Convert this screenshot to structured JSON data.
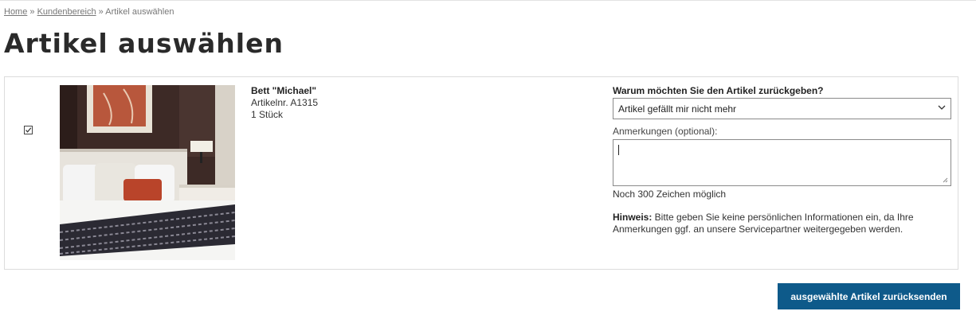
{
  "breadcrumb": {
    "items": [
      "Home",
      "Kundenbereich",
      "Artikel auswählen"
    ],
    "separator": "»"
  },
  "page_title": "Artikel auswählen",
  "item": {
    "checked": true,
    "name": "Bett \"Michael\"",
    "article_number": "Artikelnr. A1315",
    "quantity": "1 Stück",
    "image_icon": "bedroom-photo"
  },
  "return_form": {
    "reason_label": "Warum möchten Sie den Artikel zurückgeben?",
    "reason_selected": "Artikel gefällt mir nicht mehr",
    "notes_label": "Anmerkungen (optional):",
    "notes_value": "",
    "char_count": "Noch 300 Zeichen möglich",
    "hint_bold": "Hinweis:",
    "hint_text": " Bitte geben Sie keine persönlichen Informationen ein, da Ihre Anmerkungen ggf. an unsere Servicepartner weitergegeben werden."
  },
  "submit_label": "ausgewählte Artikel zurücksenden",
  "colors": {
    "accent": "#0e5a8a"
  }
}
